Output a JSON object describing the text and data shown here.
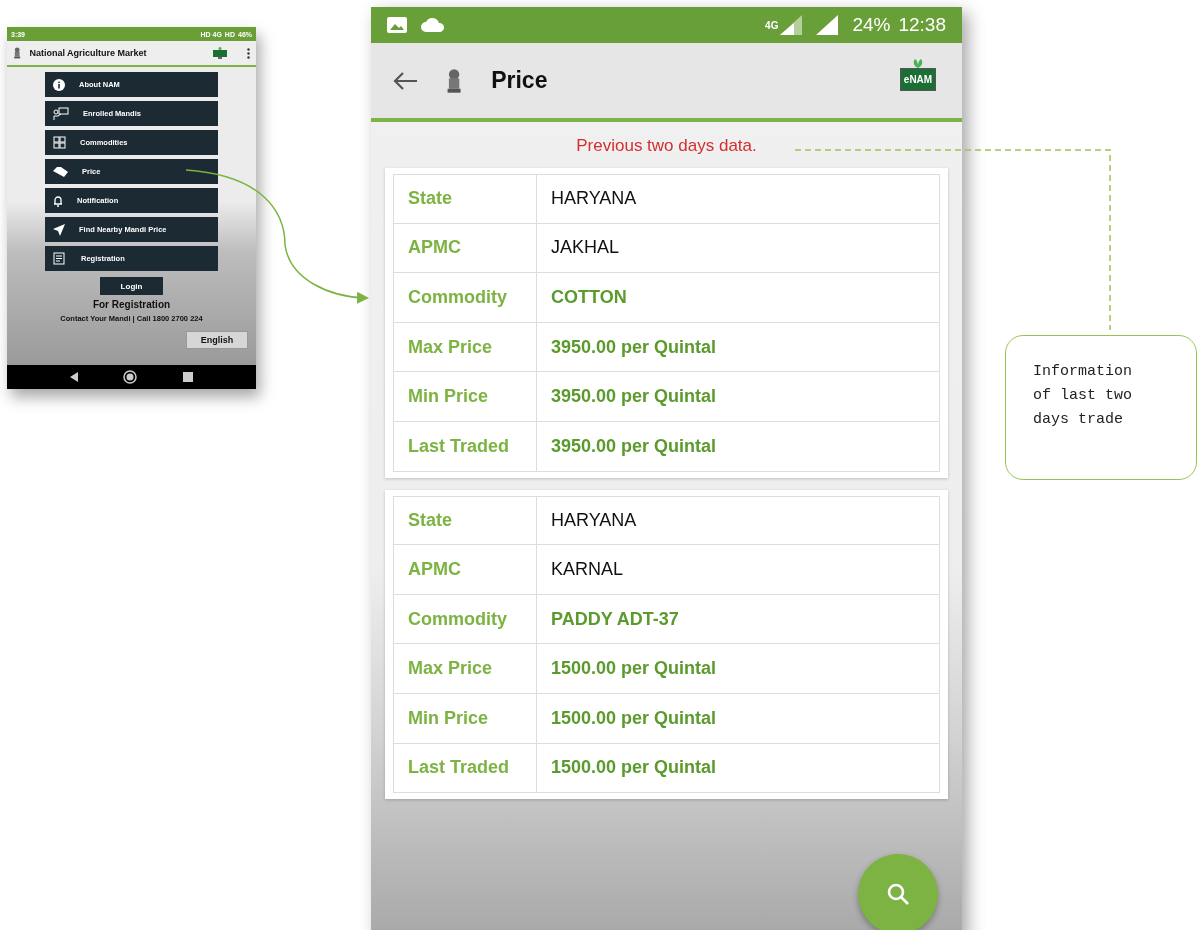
{
  "menu_screen": {
    "status_bar": {
      "time": "3:39",
      "network": "HD 4G",
      "network_2": "HD",
      "battery": "46%"
    },
    "app_bar": {
      "title": "National Agriculture Market"
    },
    "menu_items": [
      {
        "label": "About NAM",
        "kind": "info"
      },
      {
        "label": "Enrolled Mandis",
        "kind": "mandis"
      },
      {
        "label": "Commodities",
        "kind": "commodities"
      },
      {
        "label": "Price",
        "kind": "price"
      },
      {
        "label": "Notification",
        "kind": "notification"
      },
      {
        "label": "Find Nearby Mandi Price",
        "kind": "nearby"
      },
      {
        "label": "Registration",
        "kind": "registration"
      }
    ],
    "login_button": "Login",
    "registration_heading": "For Registration",
    "contact": "Contact Your Mandi | Call 1800 2700 224",
    "language_button": "English"
  },
  "price_screen": {
    "status_bar": {
      "network": "4G",
      "battery": "24%",
      "time": "12:38"
    },
    "app_bar": {
      "title": "Price",
      "logo_text": "eNAM"
    },
    "notice": "Previous two days data.",
    "records": [
      {
        "fields": [
          {
            "label": "State",
            "value": "HARYANA",
            "highlight": false
          },
          {
            "label": "APMC",
            "value": "JAKHAL",
            "highlight": false
          },
          {
            "label": "Commodity",
            "value": "COTTON",
            "highlight": true
          },
          {
            "label": "Max Price",
            "value": "3950.00 per Quintal",
            "highlight": true
          },
          {
            "label": "Min Price",
            "value": "3950.00 per Quintal",
            "highlight": true
          },
          {
            "label": "Last Traded",
            "value": "3950.00 per Quintal",
            "highlight": true
          }
        ]
      },
      {
        "fields": [
          {
            "label": "State",
            "value": "HARYANA",
            "highlight": false
          },
          {
            "label": "APMC",
            "value": "KARNAL",
            "highlight": false
          },
          {
            "label": "Commodity",
            "value": "PADDY ADT-37",
            "highlight": true
          },
          {
            "label": "Max Price",
            "value": "1500.00 per Quintal",
            "highlight": true
          },
          {
            "label": "Min Price",
            "value": "1500.00 per Quintal",
            "highlight": true
          },
          {
            "label": "Last Traded",
            "value": "1500.00 per Quintal",
            "highlight": true
          }
        ]
      }
    ]
  },
  "callout": {
    "text": "Information of last two days trade"
  }
}
